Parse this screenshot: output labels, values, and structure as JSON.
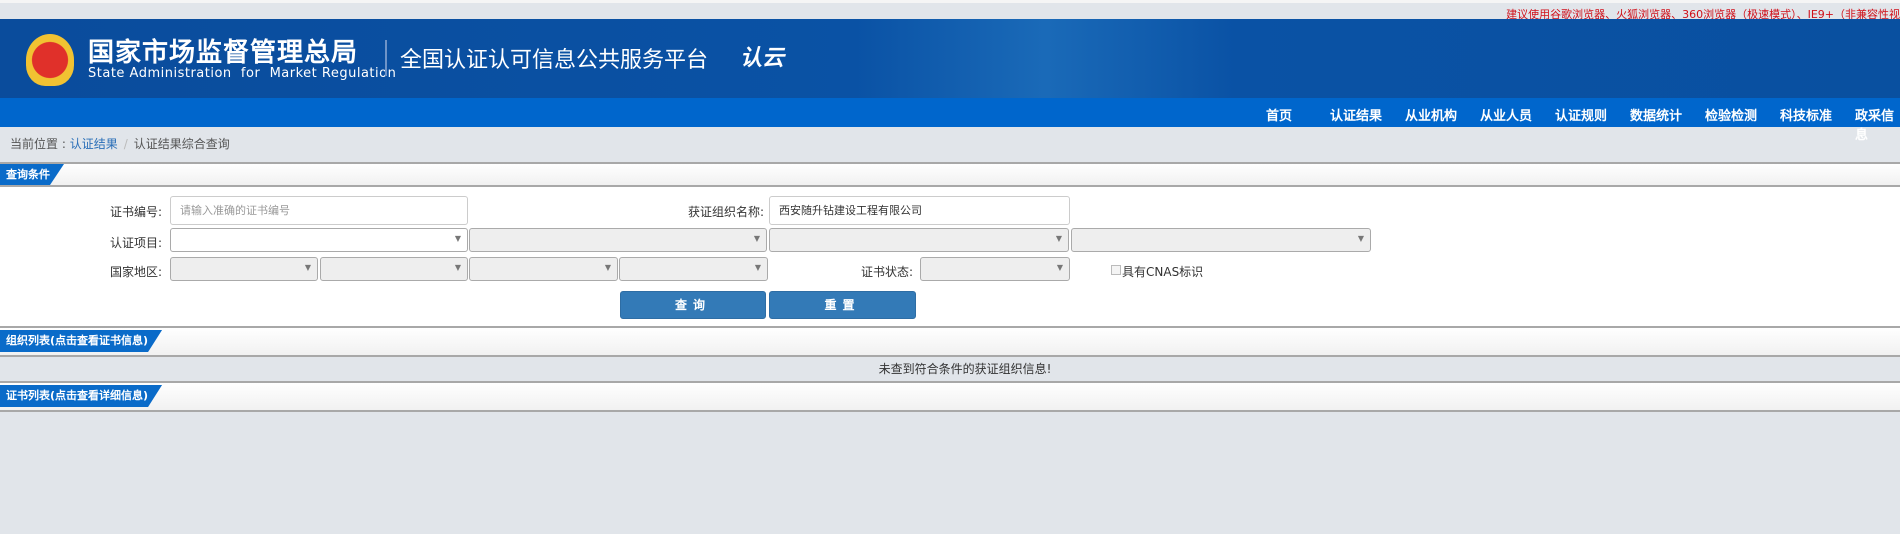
{
  "top_tip": "建议使用谷歌浏览器、火狐浏览器、360浏览器（极速模式）、IE9+（非兼容性视",
  "header": {
    "org_cn": "国家市场监督管理总局",
    "org_en": "State Administration  for  Market Regulation",
    "platform": "全国认证认可信息公共服务平台",
    "logo_text": "认云"
  },
  "nav": [
    "首页",
    "认证结果",
    "从业机构",
    "从业人员",
    "认证规则",
    "数据统计",
    "检验检测",
    "科技标准",
    "政采信息"
  ],
  "breadcrumb": {
    "prefix": "当前位置 : ",
    "link": "认证结果",
    "sep": "/",
    "current": "认证结果综合查询"
  },
  "query": {
    "title": "查询条件",
    "cert_no_label": "证书编号:",
    "cert_no_placeholder": "请输入准确的证书编号",
    "org_name_label": "获证组织名称:",
    "org_name_value": "西安随升钻建设工程有限公司",
    "project_label": "认证项目:",
    "region_label": "国家地区:",
    "status_label": "证书状态:",
    "cnas_label": "具有CNAS标识",
    "search_label": "查询",
    "reset_label": "重置"
  },
  "org_list": {
    "title": "组织列表(点击查看证书信息)",
    "empty": "未查到符合条件的获证组织信息!"
  },
  "cert_list": {
    "title": "证书列表(点击查看详细信息)"
  },
  "colors": {
    "banner": "#0a4c9c",
    "nav": "#0066cc",
    "tab": "#0a6bc9",
    "button": "#337ab7",
    "tip": "#d0101a"
  }
}
